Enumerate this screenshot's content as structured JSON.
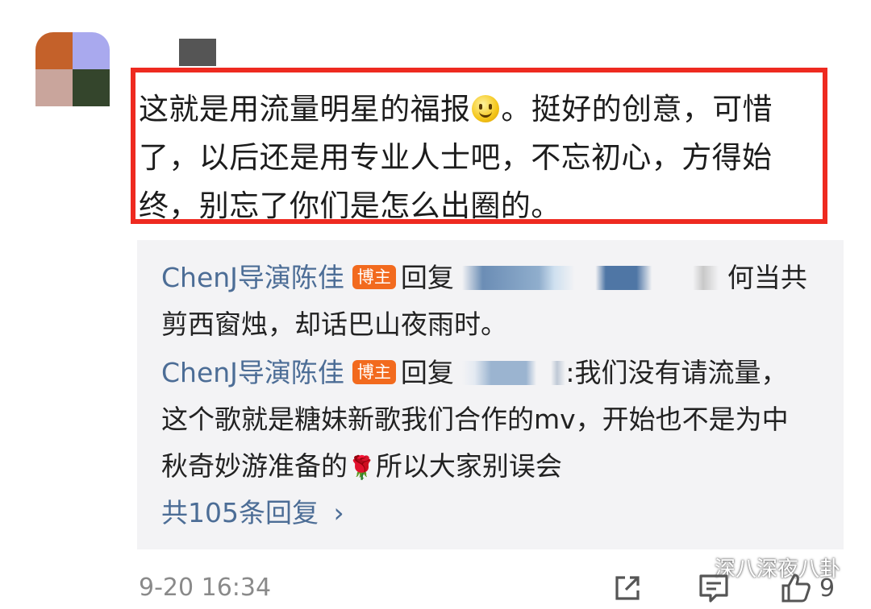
{
  "comment": {
    "text_part1": "这就是用流量明星的福报",
    "text_part2": "。挺好的创意，可惜了，以后还是用专业人士吧，不忘初心，方得始终，别忘了你们是怎么出圈的。"
  },
  "replies": [
    {
      "author": "ChenJ导演陈佳",
      "badge": "博主",
      "reply_word": "回复",
      "text_inline": "何当共",
      "text_rest": "剪西窗烛，却话巴山夜雨时。"
    },
    {
      "author": "ChenJ导演陈佳",
      "badge": "博主",
      "reply_word": "回复",
      "text_inline": ":我们没有请流量，",
      "text_rest_1": "这个歌就是糖妹新歌我们合作的mv，开始也不是为中",
      "text_rest_2a": "秋奇妙游准备的",
      "text_rest_2b": "所以大家别误会"
    }
  ],
  "more_replies": {
    "label": "共105条回复",
    "chevron": "›"
  },
  "footer": {
    "timestamp": "9-20 16:34",
    "like_count": "9",
    "icons": [
      "share-icon",
      "comment-icon",
      "like-icon"
    ]
  },
  "watermark": {
    "text": "深八深夜八卦",
    "icon": "wechat-icon"
  },
  "colors": {
    "highlight_border": "#ee2a20",
    "username": "#4c6d96",
    "badge": "#f26a1e",
    "reply_background": "#f3f3f5"
  }
}
